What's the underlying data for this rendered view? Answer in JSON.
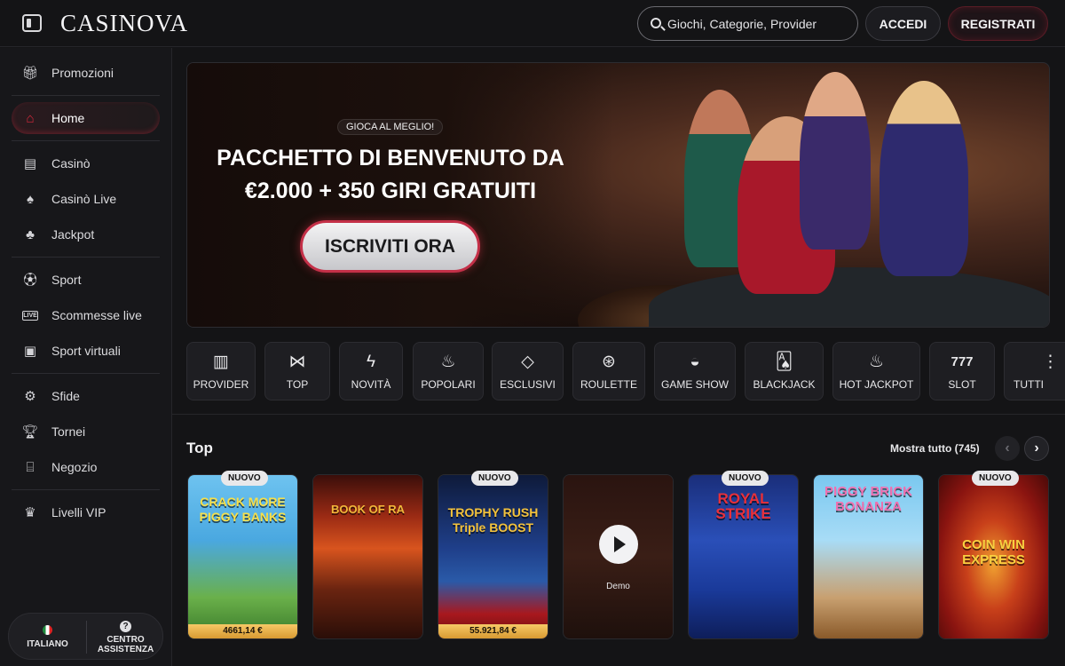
{
  "header": {
    "logo": "CASINOVA",
    "search_placeholder": "Giochi, Categorie, Provider",
    "login_label": "ACCEDI",
    "register_label": "REGISTRATI"
  },
  "sidebar": {
    "items": [
      {
        "label": "Promozioni",
        "icon": "gift-icon"
      },
      {
        "label": "Home",
        "icon": "home-icon"
      },
      {
        "label": "Casinò",
        "icon": "slot-machine-icon"
      },
      {
        "label": "Casinò Live",
        "icon": "live-dealer-icon"
      },
      {
        "label": "Jackpot",
        "icon": "clover-icon"
      },
      {
        "label": "Sport",
        "icon": "soccer-ball-icon"
      },
      {
        "label": "Scommesse live",
        "icon": "live-badge-icon"
      },
      {
        "label": "Sport virtuali",
        "icon": "virtual-sport-icon"
      },
      {
        "label": "Sfide",
        "icon": "challenge-icon"
      },
      {
        "label": "Tornei",
        "icon": "trophy-icon"
      },
      {
        "label": "Negozio",
        "icon": "shop-icon"
      },
      {
        "label": "Livelli VIP",
        "icon": "crown-icon"
      }
    ],
    "language_label": "ITALIANO",
    "support_label_line1": "CENTRO",
    "support_label_line2": "ASSISTENZA"
  },
  "hero": {
    "tagline": "GIOCA AL MEGLIO!",
    "title_line1": "PACCHETTO DI BENVENUTO DA",
    "title_line2": "€2.000 + 350 GIRI GRATUITI",
    "cta": "ISCRIVITI ORA"
  },
  "categories": [
    {
      "label": "PROVIDER",
      "icon": "book-icon"
    },
    {
      "label": "TOP",
      "icon": "bowtie-icon"
    },
    {
      "label": "NOVITÀ",
      "icon": "lightning-icon"
    },
    {
      "label": "POPOLARI",
      "icon": "flame-icon"
    },
    {
      "label": "ESCLUSIVI",
      "icon": "diamond-icon"
    },
    {
      "label": "ROULETTE",
      "icon": "roulette-icon"
    },
    {
      "label": "GAME SHOW",
      "icon": "mask-icon"
    },
    {
      "label": "BLACKJACK",
      "icon": "cards-icon"
    },
    {
      "label": "HOT JACKPOT",
      "icon": "hot-money-icon"
    },
    {
      "label": "SLOT",
      "icon": "seven-icon"
    },
    {
      "label": "TUTTI",
      "icon": "all-icon"
    }
  ],
  "top_section": {
    "title": "Top",
    "show_all": "Mostra tutto (745)"
  },
  "games": [
    {
      "title": "CRACK MORE PIGGY BANKS",
      "badge": "NUOVO",
      "jackpot": "4661,14 €",
      "accent": "#3a9be0"
    },
    {
      "title": "BOOK OF RA",
      "badge": "",
      "jackpot": "",
      "accent": "#b8401e"
    },
    {
      "title": "TROPHY RUSH Triple BOOST",
      "badge": "NUOVO",
      "jackpot": "55.921,84 €",
      "accent": "#1f3f8a"
    },
    {
      "title": "",
      "badge": "",
      "jackpot": "",
      "demo": "Demo",
      "accent": "#3a1e16"
    },
    {
      "title": "ROYAL STRIKE",
      "badge": "NUOVO",
      "jackpot": "",
      "accent": "#1f4fb8"
    },
    {
      "title": "PIGGY BRICK BONANZA",
      "badge": "",
      "jackpot": "",
      "accent": "#6ab6e6"
    },
    {
      "title": "COIN WIN EXPRESS",
      "badge": "NUOVO",
      "jackpot": "",
      "accent": "#b8281e"
    }
  ]
}
